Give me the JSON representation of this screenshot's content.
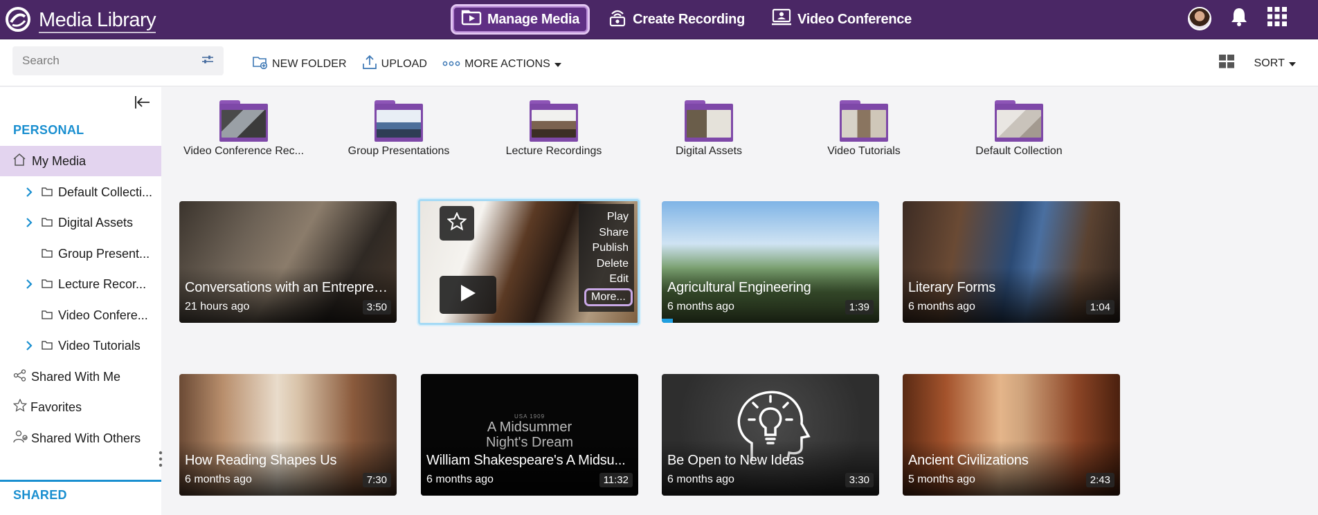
{
  "app": {
    "title": "Media Library",
    "nav": [
      {
        "label": "Manage Media",
        "icon": "media-icon",
        "active": true
      },
      {
        "label": "Create Recording",
        "icon": "recording-icon",
        "active": false
      },
      {
        "label": "Video Conference",
        "icon": "conference-icon",
        "active": false
      }
    ]
  },
  "toolbar": {
    "search_placeholder": "Search",
    "new_folder": "NEW FOLDER",
    "upload": "UPLOAD",
    "more_actions": "MORE ACTIONS",
    "sort": "SORT"
  },
  "sidebar": {
    "personal_title": "PERSONAL",
    "shared_title": "SHARED",
    "my_media": "My Media",
    "folders": [
      {
        "label": "Default Collecti...",
        "expandable": true
      },
      {
        "label": "Digital Assets",
        "expandable": true
      },
      {
        "label": "Group Present...",
        "expandable": false
      },
      {
        "label": "Lecture Recor...",
        "expandable": true
      },
      {
        "label": "Video Confere...",
        "expandable": false
      },
      {
        "label": "Video Tutorials",
        "expandable": true
      }
    ],
    "shared_with_me": "Shared With Me",
    "favorites": "Favorites",
    "shared_with_others": "Shared With Others"
  },
  "folders": [
    {
      "label": "Video Conference Rec..."
    },
    {
      "label": "Group Presentations"
    },
    {
      "label": "Lecture Recordings"
    },
    {
      "label": "Digital Assets"
    },
    {
      "label": "Video Tutorials"
    },
    {
      "label": "Default Collection"
    }
  ],
  "media": [
    {
      "title": "Conversations with an Entrepren...",
      "date": "21 hours ago",
      "duration": "3:50"
    },
    {
      "title": "",
      "date": "",
      "duration": ""
    },
    {
      "title": "Agricultural Engineering",
      "date": "6 months ago",
      "duration": "1:39",
      "progress": 0.05
    },
    {
      "title": "Literary Forms",
      "date": "6 months ago",
      "duration": "1:04"
    },
    {
      "title": "How Reading Shapes Us",
      "date": "6 months ago",
      "duration": "7:30"
    },
    {
      "title": "William Shakespeare's A Midsu...",
      "date": "6 months ago",
      "duration": "11:32",
      "poster": {
        "line1": "A Midsummer",
        "line2": "Night's Dream",
        "small": "USA 1909"
      }
    },
    {
      "title": "Be Open to New Ideas",
      "date": "6 months ago",
      "duration": "3:30"
    },
    {
      "title": "Ancient Civilizations",
      "date": "5 months ago",
      "duration": "2:43"
    }
  ],
  "context_menu": [
    "Play",
    "Share",
    "Publish",
    "Delete",
    "Edit",
    "More..."
  ]
}
